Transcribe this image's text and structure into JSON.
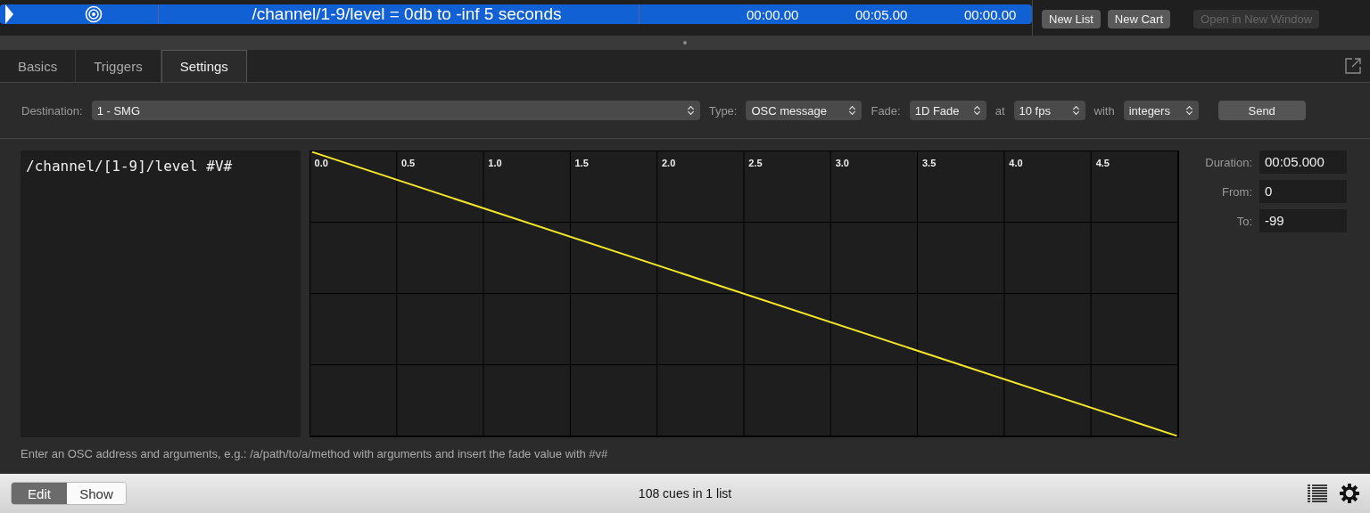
{
  "cue_row": {
    "selected": true,
    "name": "/channel/1-9/level = 0db to -inf 5 seconds",
    "times": [
      "00:00.00",
      "00:05.00",
      "00:00.00"
    ]
  },
  "top_buttons": [
    {
      "label": "New List",
      "disabled": false
    },
    {
      "label": "New Cart",
      "disabled": false
    },
    {
      "label": "Open in New Window",
      "disabled": true
    }
  ],
  "tabs": [
    {
      "label": "Basics",
      "selected": false
    },
    {
      "label": "Triggers",
      "selected": false
    },
    {
      "label": "Settings",
      "selected": true
    }
  ],
  "settings": {
    "destination_label": "Destination:",
    "destination": "1 - SMG",
    "type_label": "Type:",
    "type": "OSC message",
    "fade_label": "Fade:",
    "fade": "1D Fade",
    "at_label": "at",
    "fps": "10 fps",
    "with_label": "with",
    "number_type": "integers",
    "send": "Send"
  },
  "message": "/channel/[1-9]/level #V#",
  "graph": {
    "x_labels": [
      "0.0",
      "0.5",
      "1.0",
      "1.5",
      "2.0",
      "2.5",
      "3.0",
      "3.5",
      "4.0",
      "4.5"
    ]
  },
  "fields": [
    {
      "label": "Duration:",
      "value": "00:05.000"
    },
    {
      "label": "From:",
      "value": "0"
    },
    {
      "label": "To:",
      "value": "-99"
    }
  ],
  "hint": "Enter an OSC address and arguments, e.g.: /a/path/to/a/method with arguments and insert the fade value with #v#",
  "mode": [
    {
      "label": "Edit",
      "selected": true
    },
    {
      "label": "Show",
      "selected": false
    }
  ],
  "status": "108 cues in 1 list"
}
